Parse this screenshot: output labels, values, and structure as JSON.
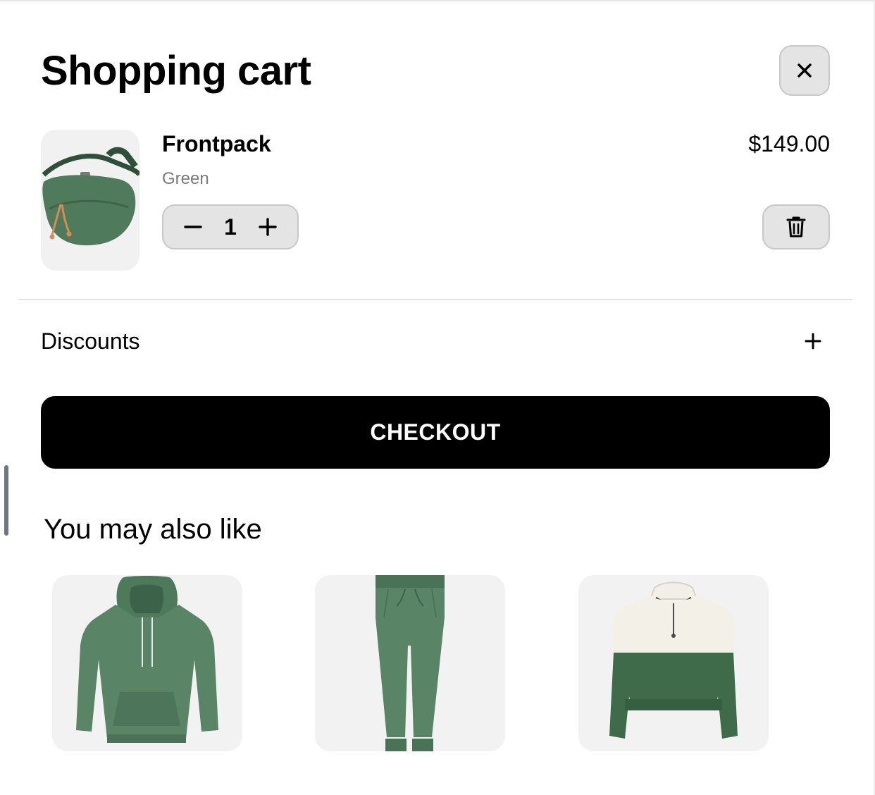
{
  "cart": {
    "title": "Shopping cart",
    "items": [
      {
        "name": "Frontpack",
        "variant": "Green",
        "price": "$149.00",
        "quantity": "1",
        "image": "green-belt-bag"
      }
    ]
  },
  "icons": {
    "close": "close-icon",
    "decrease": "minus-icon",
    "increase": "plus-icon",
    "delete": "trash-icon",
    "discounts_toggle": "plus-icon"
  },
  "discounts": {
    "label": "Discounts"
  },
  "checkout": {
    "label": "CHECKOUT"
  },
  "recommendations": {
    "title": "You may also like",
    "items": [
      {
        "image": "green-hoodie"
      },
      {
        "image": "green-sweatpants"
      },
      {
        "image": "cream-green-half-zip-crop"
      }
    ]
  },
  "colors": {
    "accent": "#000000",
    "product_green": "#4f7a5c",
    "surface": "#e4e4e4",
    "card": "#f2f2f2"
  }
}
